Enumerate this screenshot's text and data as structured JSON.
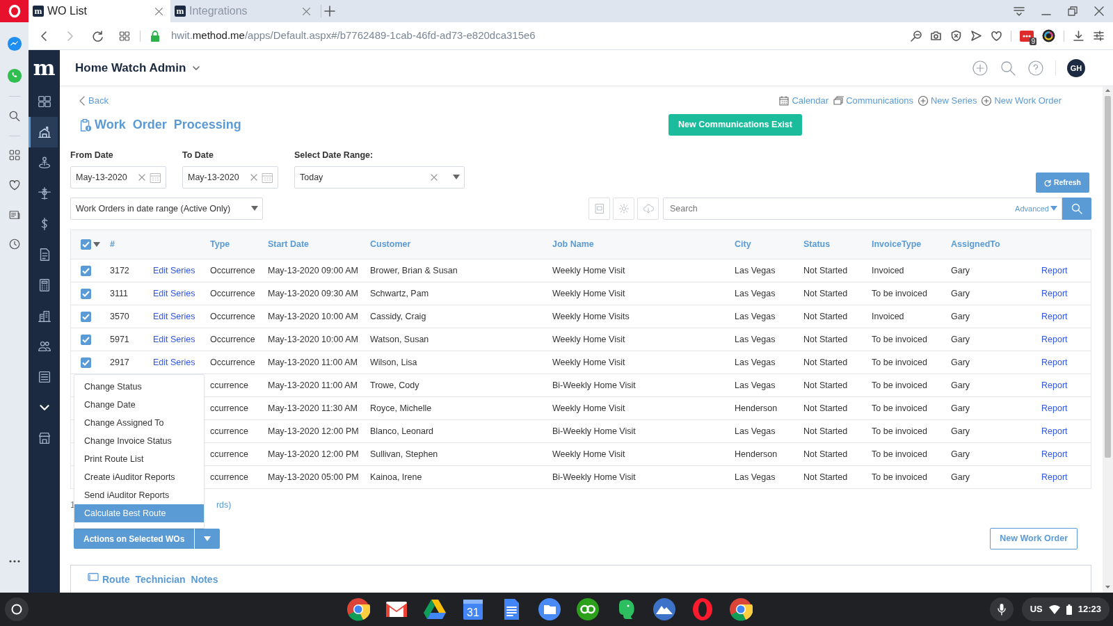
{
  "browser": {
    "tabs": [
      {
        "favicon": "m",
        "title": "WO List",
        "selected": true
      },
      {
        "favicon": "m",
        "title": "Integrations",
        "selected": false
      }
    ],
    "url": {
      "prefix": "hwit.",
      "domain": "method.me",
      "path": "/apps/Default.aspx#/b7762489-1cab-46fd-ad73-e820dca315e6"
    },
    "extension_badge": "9"
  },
  "app": {
    "logo": "m",
    "title": "Home Watch Admin",
    "avatar": "GH",
    "sidebar": [
      {
        "kind": "dashboard",
        "selected": false
      },
      {
        "kind": "house",
        "selected": true
      },
      {
        "kind": "person-pin",
        "selected": false
      },
      {
        "kind": "plane",
        "selected": false
      },
      {
        "kind": "dollar",
        "selected": false
      },
      {
        "kind": "document",
        "selected": false
      },
      {
        "kind": "calculator",
        "selected": false
      },
      {
        "kind": "buildings",
        "selected": false
      },
      {
        "kind": "people",
        "selected": false
      },
      {
        "kind": "list",
        "selected": false
      },
      {
        "kind": "chevron",
        "selected": false
      },
      {
        "kind": "store",
        "selected": false
      }
    ]
  },
  "page": {
    "back": "Back",
    "title": "Work Order Processing",
    "links": [
      {
        "kind": "calendar",
        "label": "Calendar"
      },
      {
        "kind": "communications",
        "label": "Communications"
      },
      {
        "kind": "add",
        "label": "New Series"
      },
      {
        "kind": "add",
        "label": "New Work Order"
      }
    ],
    "notice_button": "New Communications Exist",
    "from_date": {
      "label": "From Date",
      "value": "May-13-2020"
    },
    "to_date": {
      "label": "To Date",
      "value": "May-13-2020"
    },
    "date_range": {
      "label": "Select Date Range:",
      "value": "Today"
    },
    "refresh_button": "Refresh",
    "view_select": "Work Orders in date range (Active Only)",
    "search": {
      "placeholder": "Search",
      "advanced": "Advanced"
    },
    "table": {
      "select_all_checked": true,
      "columns": [
        "#",
        "Type",
        "Start Date",
        "Customer",
        "Job Name",
        "City",
        "Status",
        "InvoiceType",
        "AssignedTo"
      ],
      "rows": [
        {
          "checked": true,
          "number": "3172",
          "edit": "Edit Series",
          "type": "Occurrence",
          "start": "May-13-2020 09:00 AM",
          "customer": "Brower, Brian & Susan",
          "job": "Weekly Home Visit",
          "city": "Las Vegas",
          "status": "Not Started",
          "invoice": "Invoiced",
          "assigned": "Gary",
          "report": "Report"
        },
        {
          "checked": true,
          "number": "3111",
          "edit": "Edit Series",
          "type": "Occurrence",
          "start": "May-13-2020 09:30 AM",
          "customer": "Schwartz, Pam",
          "job": "Weekly Home Visit",
          "city": "Las Vegas",
          "status": "Not Started",
          "invoice": "To be invoiced",
          "assigned": "Gary",
          "report": "Report"
        },
        {
          "checked": true,
          "number": "3570",
          "edit": "Edit Series",
          "type": "Occurrence",
          "start": "May-13-2020 10:00 AM",
          "customer": "Cassidy, Craig",
          "job": "Weekly Home Visits",
          "city": "Las Vegas",
          "status": "Not Started",
          "invoice": "Invoiced",
          "assigned": "Gary",
          "report": "Report"
        },
        {
          "checked": true,
          "number": "5971",
          "edit": "Edit Series",
          "type": "Occurrence",
          "start": "May-13-2020 10:00 AM",
          "customer": "Watson, Susan",
          "job": "Weekly Home Visit",
          "city": "Las Vegas",
          "status": "Not Started",
          "invoice": "To be invoiced",
          "assigned": "Gary",
          "report": "Report"
        },
        {
          "checked": true,
          "number": "2917",
          "edit": "Edit Series",
          "type": "Occurrence",
          "start": "May-13-2020 11:00 AM",
          "customer": "Wilson, Lisa",
          "job": "Weekly Home Visit",
          "city": "Las Vegas",
          "status": "Not Started",
          "invoice": "To be invoiced",
          "assigned": "Gary",
          "report": "Report"
        },
        {
          "type": "ccurrence",
          "start": "May-13-2020 11:00 AM",
          "customer": "Trowe, Cody",
          "job": "Bi-Weekly Home Visit",
          "city": "Las Vegas",
          "status": "Not Started",
          "invoice": "To be invoiced",
          "assigned": "Gary",
          "report": "Report"
        },
        {
          "type": "ccurrence",
          "start": "May-13-2020 11:30 AM",
          "customer": "Royce, Michelle",
          "job": "Weekly Home Visit",
          "city": "Henderson",
          "status": "Not Started",
          "invoice": "To be invoiced",
          "assigned": "Gary",
          "report": "Report"
        },
        {
          "type": "ccurrence",
          "start": "May-13-2020 12:00 PM",
          "customer": "Blanco, Leonard",
          "job": "Bi-Weekly Home Visit",
          "city": "Las Vegas",
          "status": "Not Started",
          "invoice": "To be invoiced",
          "assigned": "Gary",
          "report": "Report"
        },
        {
          "type": "ccurrence",
          "start": "May-13-2020 12:00 PM",
          "customer": "Sullivan, Stephen",
          "job": "Weekly Home Visit",
          "city": "Henderson",
          "status": "Not Started",
          "invoice": "To be invoiced",
          "assigned": "Gary",
          "report": "Report"
        },
        {
          "type": "ccurrence",
          "start": "May-13-2020 05:00 PM",
          "customer": "Kainoa, Irene",
          "job": "Bi-Weekly Home Visit",
          "city": "Las Vegas",
          "status": "Not Started",
          "invoice": "To be invoiced",
          "assigned": "Gary",
          "report": "Report"
        }
      ]
    },
    "record_count_start": "1",
    "record_count_end": "rds)",
    "actions_menu": [
      {
        "label": "Change Status",
        "selected": false
      },
      {
        "label": "Change Date",
        "selected": false
      },
      {
        "label": "Change Assigned To",
        "selected": false
      },
      {
        "label": "Change Invoice Status",
        "selected": false
      },
      {
        "label": "Print Route List",
        "selected": false
      },
      {
        "label": "Create iAuditor Reports",
        "selected": false
      },
      {
        "label": "Send iAuditor Reports",
        "selected": false
      },
      {
        "label": "Calculate Best Route",
        "selected": true
      }
    ],
    "actions_button": "Actions on Selected WOs",
    "new_work_order_button": "New Work Order",
    "notes_title": "Route Technician Notes"
  },
  "taskbar": {
    "calendar_day": "31",
    "keyboard": "US",
    "time": "12:23"
  }
}
